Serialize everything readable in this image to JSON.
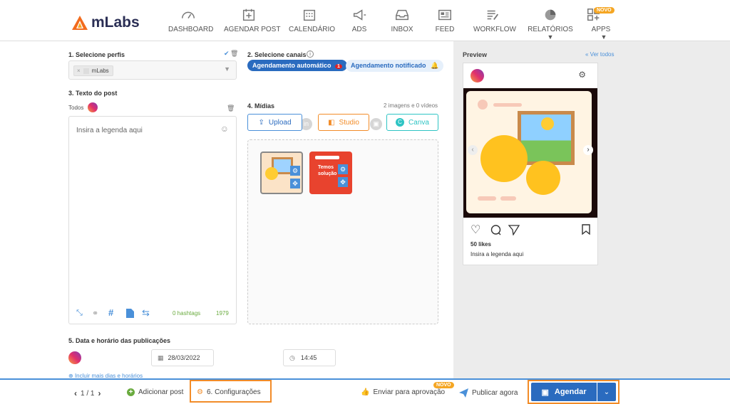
{
  "brand": {
    "name": "mLabs"
  },
  "nav": [
    {
      "label": "DASHBOARD",
      "icon": "gauge-icon"
    },
    {
      "label": "AGENDAR POST",
      "icon": "calendar-plus-icon"
    },
    {
      "label": "CALENDÁRIO",
      "icon": "calendar-icon"
    },
    {
      "label": "ADS",
      "icon": "megaphone-icon"
    },
    {
      "label": "INBOX",
      "icon": "inbox-icon"
    },
    {
      "label": "FEED",
      "icon": "feed-icon"
    },
    {
      "label": "WORKFLOW",
      "icon": "workflow-icon"
    },
    {
      "label": "RELATÓRIOS",
      "icon": "pie-chart-icon",
      "arrow": "▼"
    },
    {
      "label": "APPS",
      "icon": "apps-icon",
      "badge": "NOVO",
      "arrow": "▼"
    }
  ],
  "section1": {
    "title": "1. Selecione perfis",
    "profile_value": "mLabs",
    "remove": "×"
  },
  "section2": {
    "title": "2. Selecione canais",
    "chip_auto": "Agendamento automático",
    "chip_auto_count": "1",
    "chip_notif": "Agendamento notificado"
  },
  "section3": {
    "title": "3. Texto do post",
    "tab_all": "Todos",
    "placeholder": "Insira a legenda aqui",
    "hashtags": "0 hashtags",
    "char_count": "1979"
  },
  "section4": {
    "title": "4. Mídias",
    "count": "2 imagens e 0 vídeos",
    "upload": "Upload",
    "studio": "Studio",
    "canva": "Canva",
    "thumb2_text": "Temos solução"
  },
  "section5": {
    "title": "5. Data e horário das publicações",
    "date": "28/03/2022",
    "time": "14:45",
    "more": "Incluir mais dias e horários"
  },
  "preview": {
    "title": "Preview",
    "see_all": "Ver todos",
    "likes": "50 likes",
    "caption": "Insira a legenda aqui"
  },
  "footer": {
    "pagination": "1 / 1",
    "add_post": "Adicionar post",
    "settings": "6. Configurações",
    "approval": "Enviar para aprovação",
    "approval_badge": "NOVO",
    "publish_now": "Publicar agora",
    "schedule": "Agendar"
  }
}
